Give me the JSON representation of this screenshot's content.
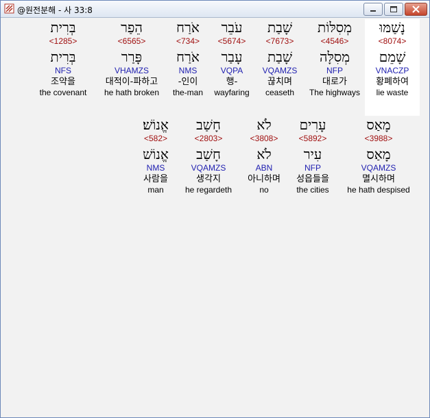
{
  "window": {
    "title": "@원전분해 - 사 33:8",
    "icon": "bible-book-icon",
    "close_color": "#c4452c"
  },
  "colors": {
    "strong": "#a01010",
    "parse": "#2020b0",
    "selected_bg": "#ffffff"
  },
  "rows": [
    [
      {
        "hebrew": "נָשַׁמּוּ",
        "strong": "<8074>",
        "lemma": "שָׁמֵם",
        "parse": "VNACZP",
        "korean": "황폐하여",
        "english": "lie waste",
        "selected": true
      },
      {
        "hebrew": "מְסִלּוֹת",
        "strong": "<4546>",
        "lemma": "מְסִלָּה",
        "parse": "NFP",
        "korean": "대로가",
        "english": "The highways",
        "selected": false
      },
      {
        "hebrew": "שָׁבַת",
        "strong": "<7673>",
        "lemma": "שָׁבַת",
        "parse": "VQAMZS",
        "korean": "끊치며",
        "english": "ceaseth",
        "selected": false
      },
      {
        "hebrew": "עֹבֵר",
        "strong": "<5674>",
        "lemma": "עָבַר",
        "parse": "VQPA",
        "korean": "행-",
        "english": "wayfaring",
        "selected": false
      },
      {
        "hebrew": "אֹרַח",
        "strong": "<734>",
        "lemma": "אֹרַח",
        "parse": "NMS",
        "korean": "-인이",
        "english": "the-man",
        "selected": false
      },
      {
        "hebrew": "הֵפַר",
        "strong": "<6565>",
        "lemma": "פָּרַר",
        "parse": "VHAMZS",
        "korean": "대적이-파하고",
        "english": "he hath broken",
        "selected": false
      },
      {
        "hebrew": "בְּרִית",
        "strong": "<1285>",
        "lemma": "בְּרִית",
        "parse": "NFS",
        "korean": "조약을",
        "english": "the covenant",
        "selected": false
      }
    ],
    [
      {
        "hebrew": "מָאַס",
        "strong": "<3988>",
        "lemma": "מָאַס",
        "parse": "VQAMZS",
        "korean": "멸시하며",
        "english": "he hath despised",
        "selected": false
      },
      {
        "hebrew": "עָרִים",
        "strong": "<5892>",
        "lemma": "עִיר",
        "parse": "NFP",
        "korean": "성읍들을",
        "english": "the cities",
        "selected": false
      },
      {
        "hebrew": "לֹא",
        "strong": "<3808>",
        "lemma": "לֹא",
        "parse": "ABN",
        "korean": "아니하며",
        "english": "no",
        "selected": false
      },
      {
        "hebrew": "חָשַׁב",
        "strong": "<2803>",
        "lemma": "חָשַׁב",
        "parse": "VQAMZS",
        "korean": "생각지",
        "english": "he regardeth",
        "selected": false
      },
      {
        "hebrew": "אֱנוֹשׁ׃",
        "strong": "<582>",
        "lemma": "אֱנוֹשׁ",
        "parse": "NMS",
        "korean": "사람을",
        "english": "man",
        "selected": false
      }
    ]
  ]
}
